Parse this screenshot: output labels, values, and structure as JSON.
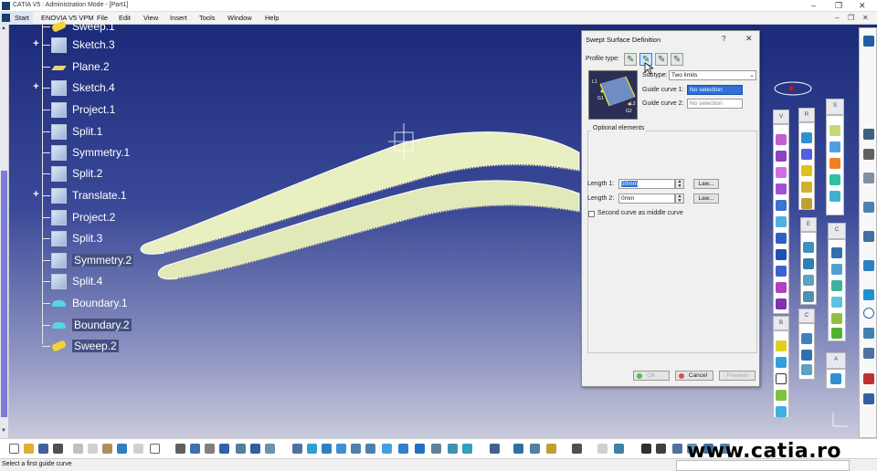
{
  "window": {
    "title": "CATIA V5 : Administration Mode - [Part1]"
  },
  "menu": {
    "items": [
      "Start",
      "ENOVIA V5 VPM",
      "File",
      "Edit",
      "View",
      "Insert",
      "Tools",
      "Window",
      "Help"
    ]
  },
  "tree": {
    "items": [
      {
        "label": "Sweep.1",
        "icon": "sweep-icon",
        "expand": false
      },
      {
        "label": "Sketch.3",
        "icon": "sketch-icon",
        "expand": true
      },
      {
        "label": "Plane.2",
        "icon": "plane-icon",
        "expand": false
      },
      {
        "label": "Sketch.4",
        "icon": "sketch-icon",
        "expand": true
      },
      {
        "label": "Project.1",
        "icon": "project-icon",
        "expand": false
      },
      {
        "label": "Split.1",
        "icon": "split-icon",
        "expand": false
      },
      {
        "label": "Symmetry.1",
        "icon": "symmetry-icon",
        "expand": false
      },
      {
        "label": "Split.2",
        "icon": "split-icon",
        "expand": false
      },
      {
        "label": "Translate.1",
        "icon": "translate-icon",
        "expand": true
      },
      {
        "label": "Project.2",
        "icon": "project-icon",
        "expand": false
      },
      {
        "label": "Split.3",
        "icon": "split-icon",
        "expand": false
      },
      {
        "label": "Symmetry.2",
        "icon": "symmetry-icon",
        "expand": false
      },
      {
        "label": "Split.4",
        "icon": "split-icon",
        "expand": false
      },
      {
        "label": "Boundary.1",
        "icon": "boundary-icon",
        "expand": false
      },
      {
        "label": "Boundary.2",
        "icon": "boundary-icon",
        "expand": false
      },
      {
        "label": "Sweep.2",
        "icon": "sweep-icon",
        "expand": false
      }
    ]
  },
  "dialog": {
    "title": "Swept Surface Definition",
    "help": "?",
    "close": "✕",
    "profile_type_label": "Profile type:",
    "subtype_label": "Subtype:",
    "subtype_value": "Two limits",
    "guide1_label": "Guide curve 1:",
    "guide1_value": "No selection",
    "guide2_label": "Guide curve 2:",
    "guide2_value": "No selection",
    "optional_label": "Optional elements",
    "length1_label": "Length 1:",
    "length1_value": "50mm",
    "length2_label": "Length 2:",
    "length2_value": "0mm",
    "law_label": "Law...",
    "second_curve_label": "Second curve as middle curve",
    "ok_label": "OK",
    "cancel_label": "Cancel",
    "preview_label": "Preview",
    "preview_g1": "G1",
    "preview_g2": "G2",
    "preview_l1": "L1",
    "preview_l2": "L2"
  },
  "toolbars": {
    "heads": [
      "V",
      "R",
      "S",
      "E",
      "C",
      "B",
      "C",
      "A"
    ]
  },
  "status": {
    "message": "Select a first guide curve"
  },
  "watermark": "www.catia.ro",
  "colors": {
    "viewport_top": "#1b2b7a",
    "viewport_bottom": "#c9cadc",
    "surface": "#e8efc0",
    "tree_highlight": "#44507f",
    "selection": "#2f6fd6"
  }
}
